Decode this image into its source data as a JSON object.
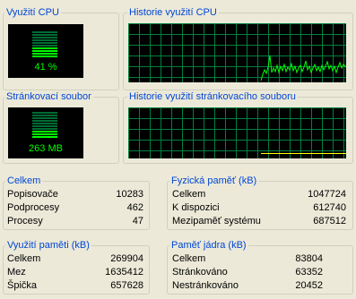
{
  "cpu": {
    "title": "Využití CPU",
    "value_text": "41 %",
    "usage_fraction": 0.41,
    "history_title": "Historie využití CPU"
  },
  "pagefile": {
    "title": "Stránkovací soubor",
    "value_text": "263 MB",
    "usage_fraction": 0.25,
    "history_title": "Historie využití stránkovacího souboru"
  },
  "colors": {
    "background": "#ece9d8",
    "group_title": "#0046d5",
    "graph_bg": "#000000",
    "grid": "#008040",
    "cpu_line": "#00ff00",
    "pagefile_line": "#ffff00",
    "meter_on": "#00ff00",
    "meter_off": "#006c34"
  },
  "totals": {
    "title": "Celkem",
    "rows": [
      {
        "label": "Popisovače",
        "value": "10283"
      },
      {
        "label": "Podprocesy",
        "value": "462"
      },
      {
        "label": "Procesy",
        "value": "47"
      }
    ]
  },
  "physical": {
    "title": "Fyzická paměť (kB)",
    "rows": [
      {
        "label": "Celkem",
        "value": "1047724"
      },
      {
        "label": "K dispozici",
        "value": "612740"
      },
      {
        "label": "Mezipaměť systému",
        "value": "687512"
      }
    ]
  },
  "commit": {
    "title": "Využití paměti (kB)",
    "rows": [
      {
        "label": "Celkem",
        "value": "269904"
      },
      {
        "label": "Mez",
        "value": "1635412"
      },
      {
        "label": "Špička",
        "value": "657628"
      }
    ]
  },
  "kernel": {
    "title": "Paměť jádra (kB)",
    "rows": [
      {
        "label": "Celkem",
        "value": "83804"
      },
      {
        "label": "Stránkováno",
        "value": "63352"
      },
      {
        "label": "Nestránkováno",
        "value": "20452"
      }
    ]
  }
}
